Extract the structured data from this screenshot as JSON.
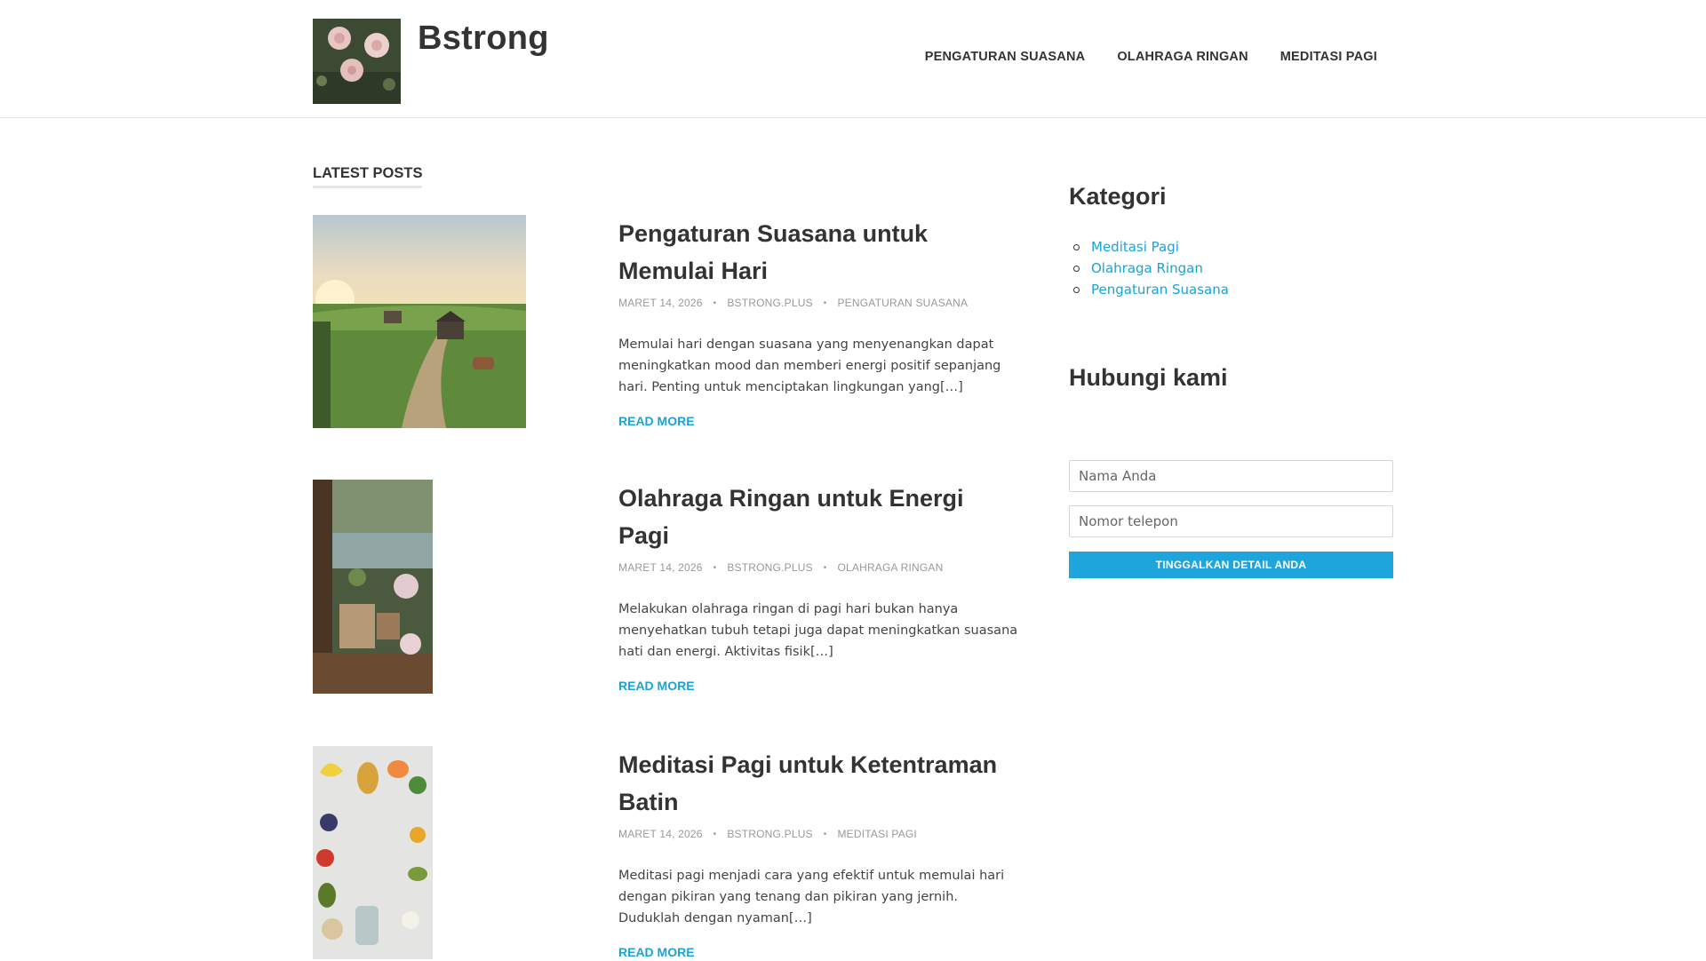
{
  "site": {
    "title": "Bstrong"
  },
  "nav": [
    {
      "label": "PENGATURAN SUASANA"
    },
    {
      "label": "OLAHRAGA RINGAN"
    },
    {
      "label": "MEDITASI PAGI"
    }
  ],
  "main": {
    "section_label": "LATEST POSTS",
    "read_more_label": "READ MORE",
    "posts": [
      {
        "title": "Pengaturan Suasana untuk Memulai Hari",
        "date": "MARET 14, 2026",
        "author": "BSTRONG.PLUS",
        "category": "PENGATURAN SUASANA",
        "excerpt": "Memulai hari dengan suasana yang menyenangkan dapat meningkatkan mood dan memberi energi positif sepanjang hari. Penting untuk menciptakan lingkungan yang[…]"
      },
      {
        "title": "Olahraga Ringan untuk Energi Pagi",
        "date": "MARET 14, 2026",
        "author": "BSTRONG.PLUS",
        "category": "OLAHRAGA RINGAN",
        "excerpt": "Melakukan olahraga ringan di pagi hari bukan hanya menyehatkan tubuh tetapi juga dapat meningkatkan suasana hati dan energi. Aktivitas fisik[…]"
      },
      {
        "title": "Meditasi Pagi untuk Ketentraman Batin",
        "date": "MARET 14, 2026",
        "author": "BSTRONG.PLUS",
        "category": "MEDITASI PAGI",
        "excerpt": "Meditasi pagi menjadi cara yang efektif untuk memulai hari dengan pikiran yang tenang dan pikiran yang jernih. Duduklah dengan nyaman[…]"
      }
    ]
  },
  "sidebar": {
    "categories_title": "Kategori",
    "categories": [
      {
        "label": "Meditasi Pagi"
      },
      {
        "label": "Olahraga Ringan"
      },
      {
        "label": "Pengaturan Suasana"
      }
    ],
    "contact_title": "Hubungi kami",
    "form": {
      "name_placeholder": "Nama Anda",
      "phone_placeholder": "Nomor telepon",
      "submit_label": "TINGGALKAN DETAIL ANDA"
    }
  },
  "colors": {
    "accent": "#1aa3d6",
    "text": "#333333",
    "meta": "#999999"
  }
}
